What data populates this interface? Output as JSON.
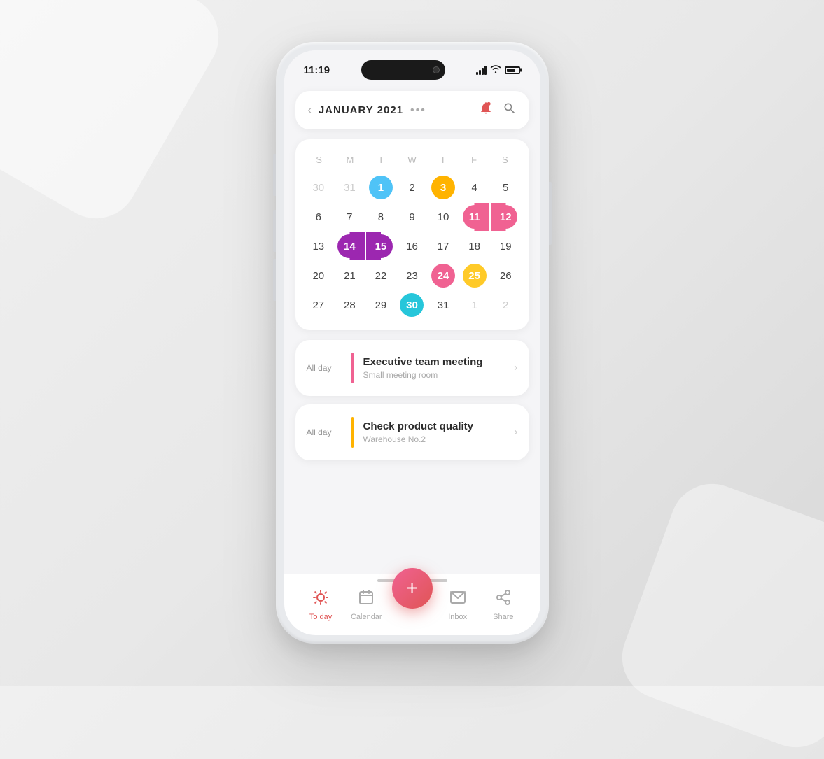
{
  "phone": {
    "statusBar": {
      "time": "11:19",
      "batteryLevel": "75"
    },
    "header": {
      "chevronLabel": "‹",
      "monthYear": "JANUARY  2021",
      "dotsLabel": "•••",
      "bellIcon": "🔔",
      "searchIcon": "🔍"
    },
    "calendar": {
      "weekdays": [
        "S",
        "M",
        "T",
        "W",
        "T",
        "F",
        "S"
      ],
      "weeks": [
        [
          {
            "day": "30",
            "style": "other-month"
          },
          {
            "day": "31",
            "style": "other-month"
          },
          {
            "day": "1",
            "style": "blue-circle"
          },
          {
            "day": "2",
            "style": "normal"
          },
          {
            "day": "3",
            "style": "orange-circle"
          },
          {
            "day": "4",
            "style": "normal"
          },
          {
            "day": "5",
            "style": "normal"
          }
        ],
        [
          {
            "day": "6",
            "style": "normal"
          },
          {
            "day": "7",
            "style": "normal"
          },
          {
            "day": "8",
            "style": "normal"
          },
          {
            "day": "9",
            "style": "normal"
          },
          {
            "day": "10",
            "style": "normal"
          },
          {
            "day": "11",
            "style": "range-pink-11"
          },
          {
            "day": "12",
            "style": "range-pink-12"
          }
        ],
        [
          {
            "day": "13",
            "style": "normal"
          },
          {
            "day": "14",
            "style": "range-purple-14"
          },
          {
            "day": "15",
            "style": "range-purple-15"
          },
          {
            "day": "16",
            "style": "normal"
          },
          {
            "day": "17",
            "style": "normal"
          },
          {
            "day": "18",
            "style": "normal"
          },
          {
            "day": "19",
            "style": "normal"
          }
        ],
        [
          {
            "day": "20",
            "style": "normal"
          },
          {
            "day": "21",
            "style": "normal"
          },
          {
            "day": "22",
            "style": "normal"
          },
          {
            "day": "23",
            "style": "normal"
          },
          {
            "day": "24",
            "style": "pink-circle"
          },
          {
            "day": "25",
            "style": "yellow-circle"
          },
          {
            "day": "26",
            "style": "normal"
          }
        ],
        [
          {
            "day": "27",
            "style": "normal"
          },
          {
            "day": "28",
            "style": "normal"
          },
          {
            "day": "29",
            "style": "normal"
          },
          {
            "day": "30",
            "style": "cyan-circle"
          },
          {
            "day": "31",
            "style": "normal"
          },
          {
            "day": "1",
            "style": "other-month"
          },
          {
            "day": "2",
            "style": "other-month"
          }
        ]
      ]
    },
    "events": [
      {
        "time": "All day",
        "title": "Executive team meeting",
        "location": "Small meeting room",
        "dividerColor": "pink"
      },
      {
        "time": "All day",
        "title": "Check product quality",
        "location": "Warehouse  No.2",
        "dividerColor": "orange"
      }
    ],
    "bottomNav": {
      "items": [
        {
          "icon": "☀",
          "label": "To day",
          "active": true
        },
        {
          "icon": "📅",
          "label": "Calendar",
          "active": false
        },
        {
          "icon": "✉",
          "label": "Inbox",
          "active": false
        },
        {
          "icon": "↗",
          "label": "Share",
          "active": false
        }
      ],
      "fab": "+"
    }
  }
}
